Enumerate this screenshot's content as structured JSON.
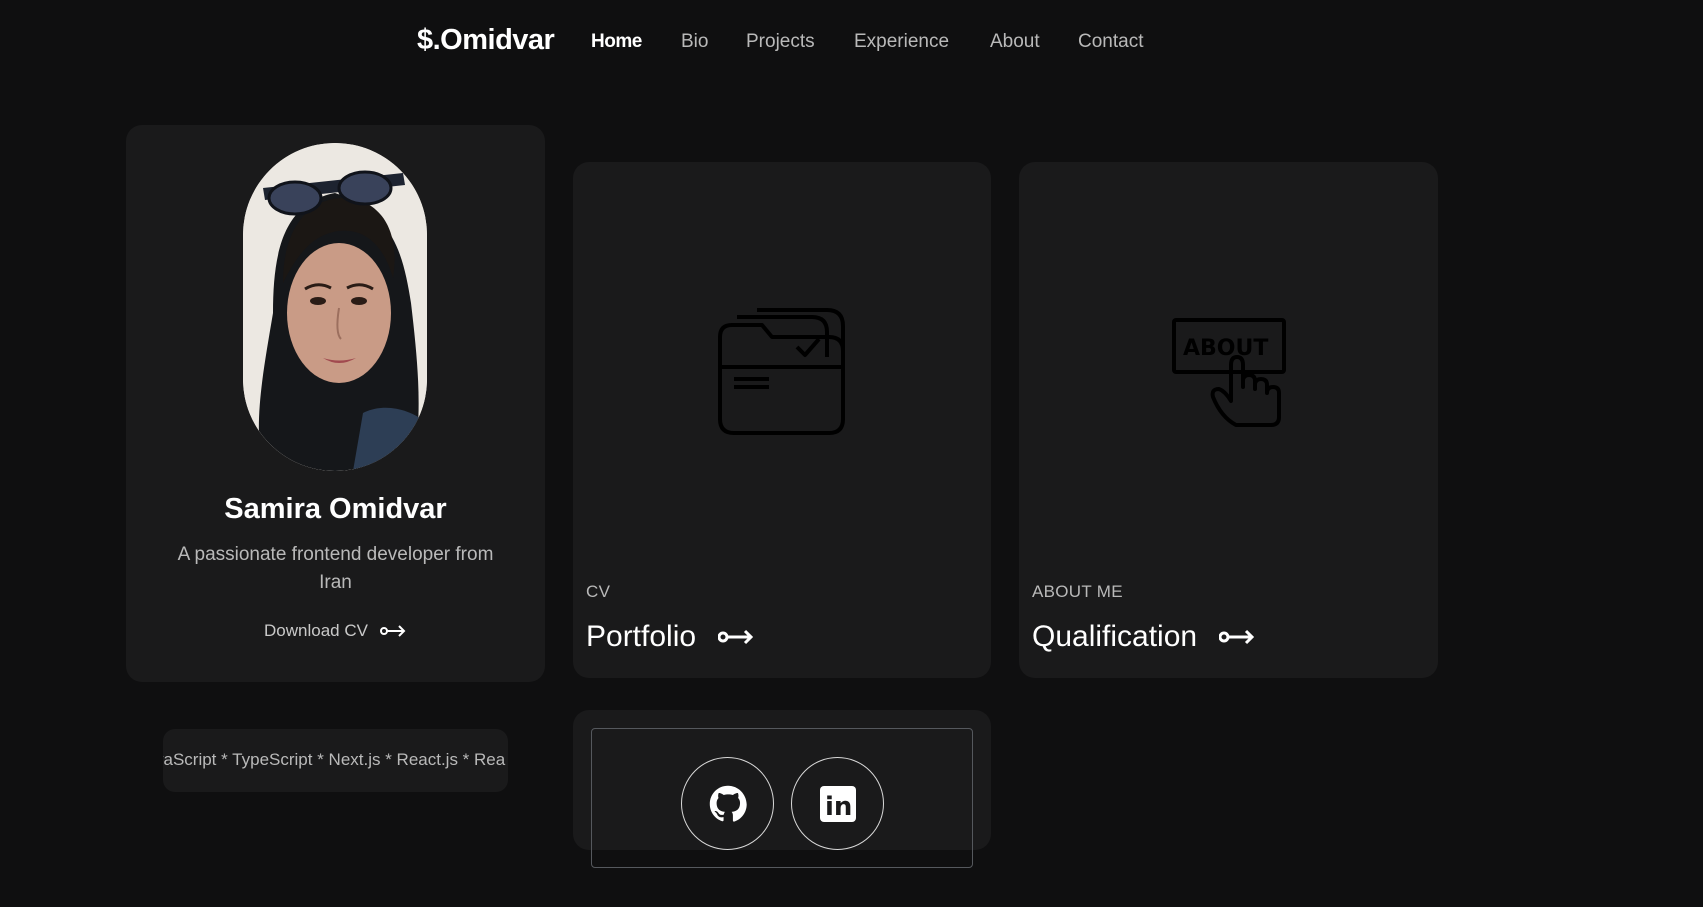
{
  "nav": {
    "brand": "$.Omidvar",
    "items": [
      {
        "label": "Home",
        "active": true
      },
      {
        "label": "Bio"
      },
      {
        "label": "Projects"
      },
      {
        "label": "Experience"
      },
      {
        "label": "About"
      },
      {
        "label": "Contact"
      }
    ]
  },
  "profile": {
    "name": "Samira Omidvar",
    "tagline": "A passionate frontend developer from Iran",
    "download_label": "Download CV",
    "download_icon": "arrow-right-icon"
  },
  "cards": {
    "cv": {
      "kicker": "CV",
      "title": "Portfolio",
      "icon": "folder-icon"
    },
    "about": {
      "kicker": "ABOUT ME",
      "title": "Qualification",
      "icon": "about-click-icon",
      "icon_text": "ABOUT"
    }
  },
  "skills_ticker": "vaScript * TypeScript * Next.js * React.js * Rea",
  "social": [
    {
      "name": "github",
      "icon": "github-icon"
    },
    {
      "name": "linkedin",
      "icon": "linkedin-icon",
      "icon_text": "in"
    }
  ],
  "colors": {
    "background": "#0f0f10",
    "card": "#1a1a1b",
    "muted_text": "#b9b9b9",
    "text": "#ffffff"
  }
}
